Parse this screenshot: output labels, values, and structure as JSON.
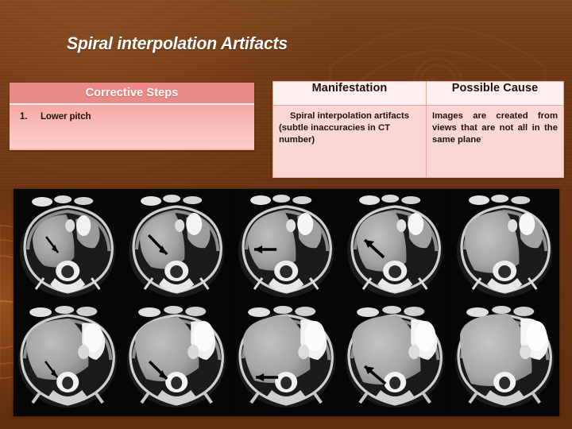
{
  "slide": {
    "title": "Spiral interpolation Artifacts",
    "background_color": "#6a3411",
    "accent_pink": "#e98a86"
  },
  "steps_table": {
    "header": "Corrective Steps",
    "items": [
      {
        "number": "1.",
        "text": "Lower pitch"
      }
    ]
  },
  "info_table": {
    "headers": [
      "Manifestation",
      "Possible Cause"
    ],
    "rows": [
      {
        "manifestation_line1": "Spiral interpolation artifacts",
        "manifestation_line2": "(subtle inaccuracies in CT number)",
        "cause": "Images are created from views that are not all in the same plane"
      }
    ]
  },
  "figure": {
    "name": "ct-axial-slice-series",
    "rows": 2,
    "columns": 5,
    "arrow_count": 8
  }
}
